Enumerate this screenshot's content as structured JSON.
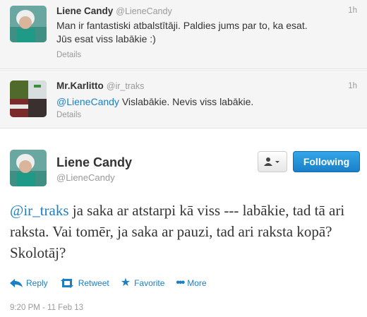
{
  "tweets": [
    {
      "name": "Liene Candy",
      "handle": "@LieneCandy",
      "time": "1h",
      "text_lines": [
        "Man ir fantastiski atbalstītāji. Paldies jums par to, ka esat.",
        "Jūs esat viss labākie :)"
      ],
      "details": "Details"
    },
    {
      "name": "Mr.Karlitto",
      "handle": "@ir_traks",
      "time": "1h",
      "mention": "@LieneCandy",
      "text": " Vislabākie. Nevis viss labākie.",
      "details": "Details"
    }
  ],
  "main": {
    "name": "Liene Candy",
    "handle": "@LieneCandy",
    "follow_label": "Following",
    "mention": "@ir_traks",
    "text_rest": " ja saka ar atstarpi kā viss --- labākie, tad tā ari raksta. Vai tomēr, ja saka ar pauzi, tad ari raksta kopā? Skolotāj?",
    "actions": {
      "reply": "Reply",
      "retweet": "Retweet",
      "favorite": "Favorite",
      "more": "More"
    },
    "timestamp": "9:20 PM - 11 Feb 13"
  },
  "colors": {
    "link": "#1a7fc5",
    "follow_bg": "#2a96dc"
  }
}
